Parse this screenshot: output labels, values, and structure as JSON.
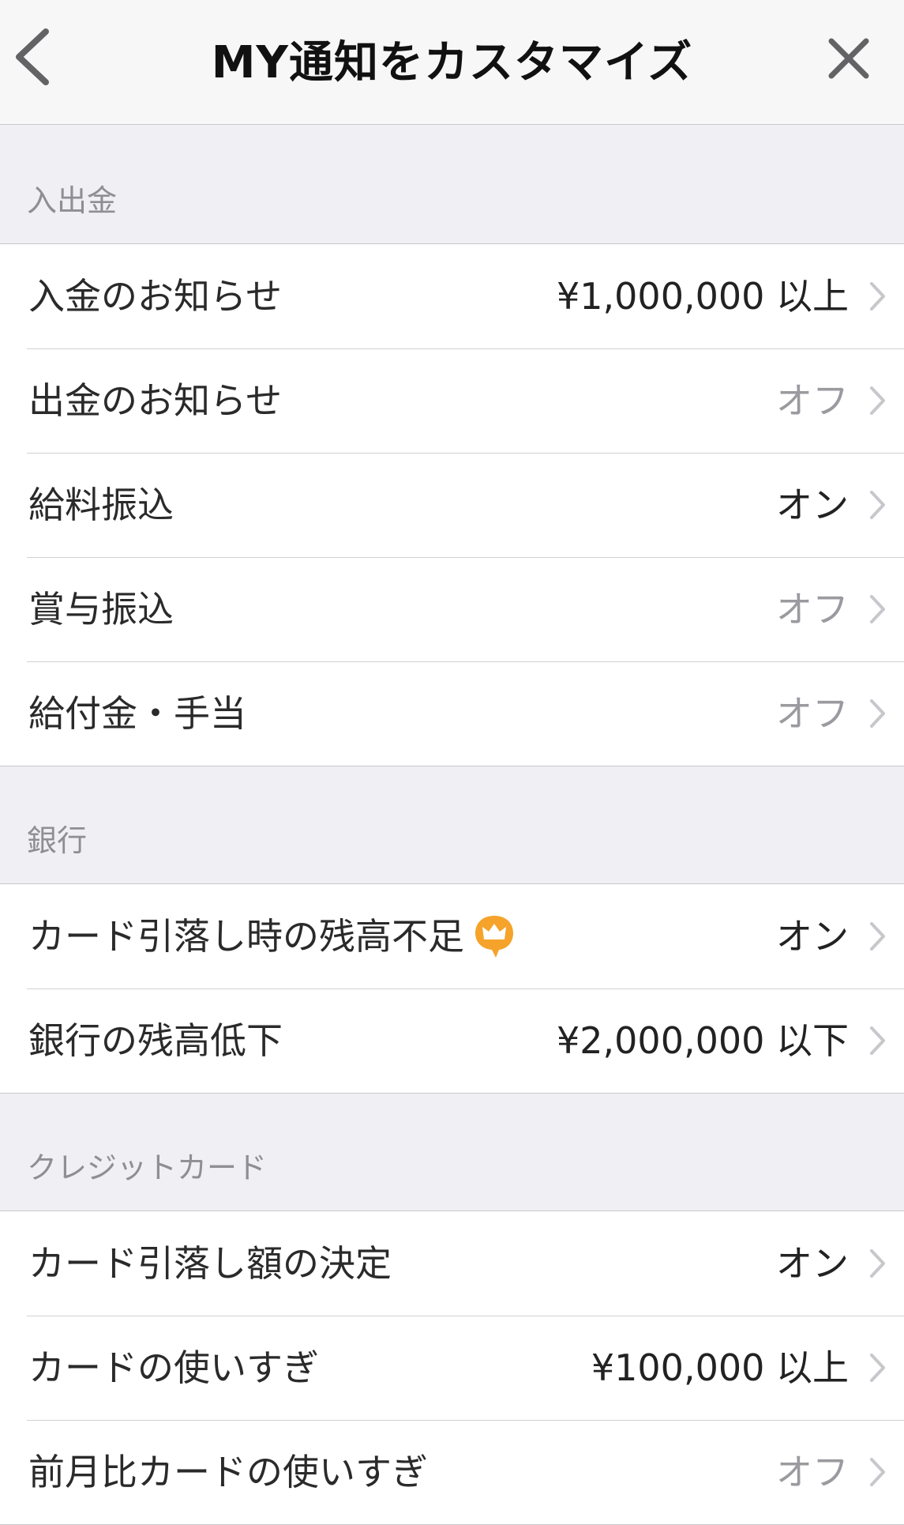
{
  "nav": {
    "title": "MY通知をカスタマイズ",
    "back_icon": "chevron-left-icon",
    "close_icon": "close-icon"
  },
  "colors": {
    "background": "#efeff4",
    "header": "#f7f7f7",
    "off_text": "#9a9a9f",
    "on_text": "#222222",
    "premium_badge": "#f5a32a",
    "chevron": "#c7c7cc"
  },
  "sections": [
    {
      "label": "入出金",
      "rows": [
        {
          "title": "入金のお知らせ",
          "value": "¥1,000,000 以上"
        },
        {
          "title": "出金のお知らせ",
          "value": "オフ"
        },
        {
          "title": "給料振込",
          "value": "オン"
        },
        {
          "title": "賞与振込",
          "value": "オフ"
        },
        {
          "title": "給付金・手当",
          "value": "オフ"
        }
      ]
    },
    {
      "label": "銀行",
      "rows": [
        {
          "title": "カード引落し時の残高不足",
          "value": "オン",
          "icon": "premium-crown-icon"
        },
        {
          "title": "銀行の残高低下",
          "value": "¥2,000,000 以下"
        }
      ]
    },
    {
      "label": "クレジットカード",
      "rows": [
        {
          "title": "カード引落し額の決定",
          "value": "オン"
        },
        {
          "title": "カードの使いすぎ",
          "value": "¥100,000 以上"
        },
        {
          "title": "前月比カードの使いすぎ",
          "value": "オフ"
        }
      ]
    }
  ]
}
